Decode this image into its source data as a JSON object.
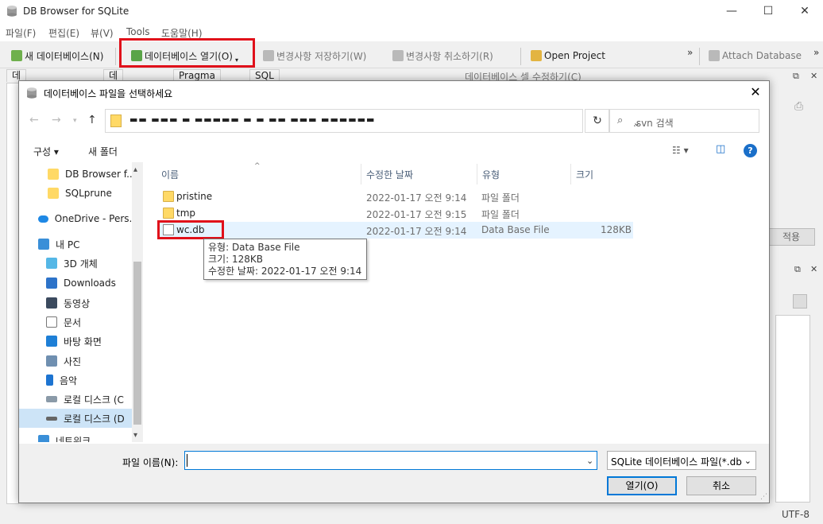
{
  "app": {
    "title": "DB Browser for SQLite",
    "window_controls": {
      "minimize": "—",
      "maximize": "☐",
      "close": "✕"
    }
  },
  "menubar": [
    "파일(F)",
    "편집(E)",
    "뷰(V)",
    "Tools",
    "도움말(H)"
  ],
  "toolbar": {
    "new_db": "새 데이터베이스(N)",
    "open_db": "데이터베이스 열기(O)",
    "write_changes": "변경사항 저장하기(W)",
    "revert_changes": "변경사항 취소하기(R)",
    "open_project": "Open Project",
    "attach_db": "Attach Database",
    "overflow": "»"
  },
  "bg_tabs": [
    "데이터베이스 구조",
    "데이터 보기",
    "Pragma 수정",
    "SQL 실행"
  ],
  "bg_right": {
    "edit_cell_title": "데이터베이스 셀 수정하기(C)",
    "apply": "적용",
    "encoding": "UTF-8"
  },
  "dialog": {
    "title": "데이터베이스 파일을 선택하세요",
    "close": "✕",
    "address_path": "▬▬ ▬▬▬ ▬ ▬▬▬▬▬ ▬ ▬ ▬▬ ▬▬▬   ▬▬▬▬▬▬",
    "search_placeholder": ".svn 검색",
    "organize": "구성 ▾",
    "new_folder": "새 폴더",
    "help": "?",
    "nav_items": [
      {
        "label": "DB Browser f..."
      },
      {
        "label": "SQLprune"
      },
      {
        "label": "OneDrive - Pers..."
      },
      {
        "label": "내 PC"
      },
      {
        "label": "3D 개체"
      },
      {
        "label": "Downloads"
      },
      {
        "label": "동영상"
      },
      {
        "label": "문서"
      },
      {
        "label": "바탕 화면"
      },
      {
        "label": "사진"
      },
      {
        "label": "음악"
      },
      {
        "label": "로컬 디스크 (C"
      },
      {
        "label": "로컬 디스크 (D"
      },
      {
        "label": "네트워크"
      }
    ],
    "columns": {
      "name": "이름",
      "modified": "수정한 날짜",
      "type": "유형",
      "size": "크기"
    },
    "files": [
      {
        "name": "pristine",
        "modified": "2022-01-17 오전 9:14",
        "type": "파일 폴더",
        "size": ""
      },
      {
        "name": "tmp",
        "modified": "2022-01-17 오전 9:15",
        "type": "파일 폴더",
        "size": ""
      },
      {
        "name": "wc.db",
        "modified": "2022-01-17 오전 9:14",
        "type": "Data Base File",
        "size": "128KB"
      }
    ],
    "tooltip": {
      "type": "유형: Data Base File",
      "size": "크기: 128KB",
      "modified": "수정한 날짜: 2022-01-17 오전 9:14"
    },
    "filename_label": "파일 이름(N):",
    "filename_value": "",
    "filter": "SQLite 데이터베이스 파일(*.db",
    "open_button": "열기(O)",
    "cancel_button": "취소"
  },
  "colors": {
    "highlight_red": "#e0101a",
    "accent_blue": "#0078d7",
    "hover_row": "#e5f3ff",
    "folder_yellow": "#ffd966"
  }
}
